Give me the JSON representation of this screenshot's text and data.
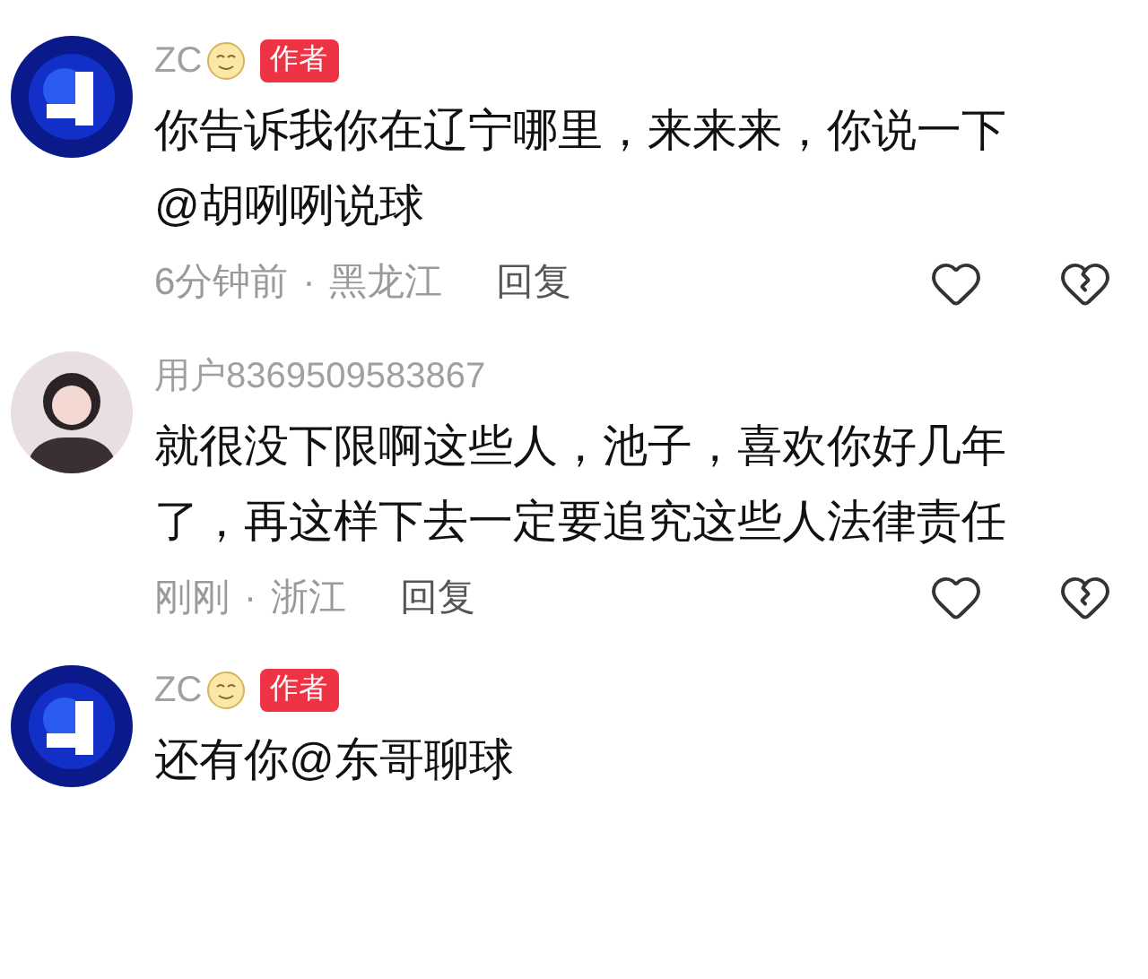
{
  "comments": [
    {
      "kind": "emblem",
      "author": "ZC",
      "name_emoji": true,
      "badge": "作者",
      "text": "你告诉我你在辽宁哪里，来来来，你说一下@胡咧咧说球",
      "time": "6分钟前",
      "separator": "·",
      "location": "黑龙江",
      "reply": "回复"
    },
    {
      "kind": "person",
      "author": "用户8369509583867",
      "name_emoji": false,
      "text": "就很没下限啊这些人，池子，喜欢你好几年了，再这样下去一定要追究这些人法律责任",
      "time": "刚刚",
      "separator": "·",
      "location": "浙江",
      "reply": "回复"
    },
    {
      "kind": "emblem",
      "author": "ZC",
      "name_emoji": true,
      "badge": "作者",
      "text": "还有你@东哥聊球"
    }
  ]
}
